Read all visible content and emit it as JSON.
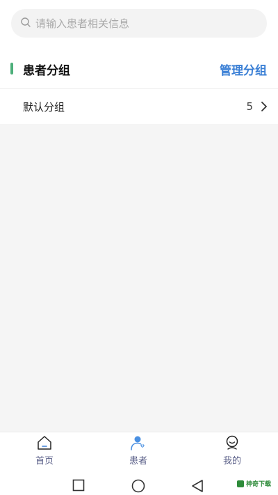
{
  "search": {
    "placeholder": "请输入患者相关信息"
  },
  "section": {
    "title": "患者分组",
    "manage_label": "管理分组"
  },
  "groups": [
    {
      "name": "默认分组",
      "count": "5"
    }
  ],
  "tabbar": {
    "items": [
      {
        "label": "首页",
        "icon": "home-icon"
      },
      {
        "label": "患者",
        "icon": "patient-icon"
      },
      {
        "label": "我的",
        "icon": "profile-icon"
      }
    ]
  },
  "watermark": {
    "text": "神奇下载"
  },
  "colors": {
    "accent_green": "#4caf7a",
    "link_blue": "#3a7fd5",
    "tab_blue": "#4a90e2"
  }
}
